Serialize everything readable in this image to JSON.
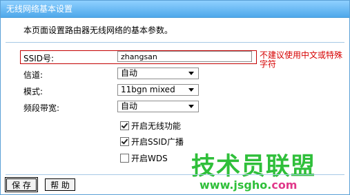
{
  "title": "无线网络基本设置",
  "intro": "本页面设置路由器无线网络的基本参数。",
  "fields": {
    "ssid": {
      "label": "SSID号:",
      "value": "zhangsan",
      "warning": "不建议使用中文或特殊字符"
    },
    "channel": {
      "label": "信道:",
      "value": "自动"
    },
    "mode": {
      "label": "模式:",
      "value": "11bgn mixed"
    },
    "bandwidth": {
      "label": "频段带宽:",
      "value": "自动"
    }
  },
  "checkboxes": [
    {
      "label": "开启无线功能",
      "checked": true
    },
    {
      "label": "开启SSID广播",
      "checked": true
    },
    {
      "label": "开启WDS",
      "checked": false
    }
  ],
  "buttons": {
    "save": "保 存",
    "help": "帮 助"
  },
  "watermark": {
    "text": "技术员联盟",
    "url_main": "www.jsgho.",
    "url_tld": "com"
  },
  "colors": {
    "title_bar": "#4ea8ea",
    "warning": "#d60000",
    "watermark_green": "#2fbf3a",
    "watermark_pink": "#e0388a"
  }
}
